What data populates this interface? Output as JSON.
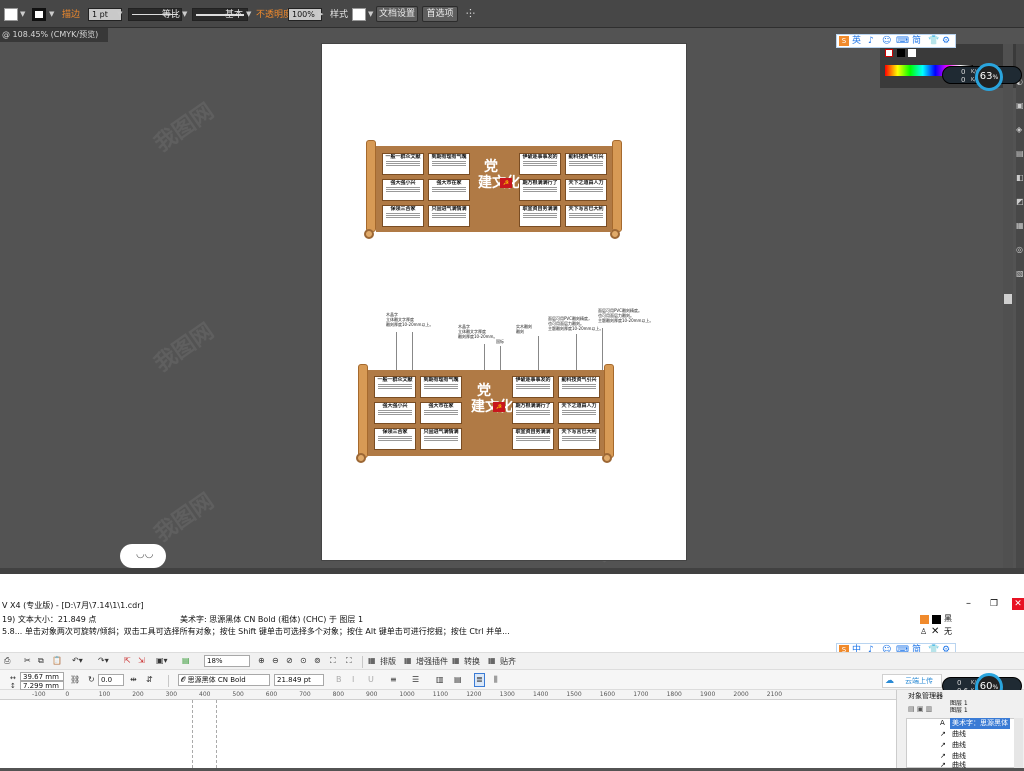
{
  "illustrator": {
    "toolbar": {
      "stroke_label": "描边",
      "stroke_weight": "1 pt",
      "stroke_profile_label": "等比",
      "brush_label": "基本",
      "opacity_label": "不透明度",
      "opacity_value": "100%",
      "style_label": "样式",
      "doc_setup_label": "文档设置",
      "prefs_label": "首选项"
    },
    "doc_tab": "@ 108.45% (CMYK/预览)"
  },
  "artwork": {
    "title_top": "党",
    "title_bottom": "建文化",
    "flag_glyph": "☭",
    "left_cards": [
      "一般一群众文献",
      "到期有理有气魄",
      "强大强小兴",
      "强大市在家",
      "保领三合家",
      "只固进气满情满"
    ],
    "right_cards": [
      "伊破逐事事发的",
      "勤科技资气引兴",
      "期万根满满行了",
      "天下之道由人力",
      "职宣资自务满满",
      "天下写言已大利"
    ],
    "annotations": {
      "a1": "木晶字\n立体雕文字厚度\n雕刻厚度10-20mm以上。",
      "a2": "木晶字\n立体雕文字厚度\n雕刻厚度10-20mm。",
      "a3": "国标",
      "a4": "实木雕刻\n雕刻",
      "a5": "面层可用PVC雕刻精度，\n也可用面层力雕刻。\n主题雕刻厚度10-20mm以上。",
      "a6": "面层可用PVC雕刻精度。\n也可用面层力雕刻。\n主题雕刻厚度10-20mm以上。"
    }
  },
  "watermark": "我图网",
  "ime_top": {
    "lang": "英",
    "items": [
      "♪",
      "☺",
      "⌨",
      "简",
      "👕",
      "⚙"
    ]
  },
  "ime_bottom": {
    "lang": "中",
    "items": [
      "♪",
      "☺",
      "⌨",
      "简",
      "👕",
      "⚙"
    ]
  },
  "speed_top": {
    "up": "0",
    "down": "0",
    "unit": "K/s",
    "percent": "63"
  },
  "speed_bottom": {
    "up": "0",
    "down": "0.6",
    "unit": "K/s",
    "percent": "60"
  },
  "corel": {
    "title": "V X4 (专业版) - [D:\\7月\\7.14\\1\\1.cdr]",
    "status1": "19) 文本大小：21.849 点",
    "status1_right": "美术字: 思源黑体 CN Bold (粗体) (CHC) 于 图层 1",
    "status2": "5.8...  单击对象两次可旋转/倾斜；双击工具可选择所有对象；按住 Shift 键单击可选择多个对象；按住 Alt 键单击可进行挖掘；按住 Ctrl 并单...",
    "fill_label": "黑",
    "outline_label": "无",
    "zoom": "18%",
    "menus": [
      "排版",
      "增强插件",
      "转换",
      "贴齐"
    ],
    "width_value": "39.67 mm",
    "height_value": "7.299 mm",
    "angle_value": "0.0",
    "font_name": "思源黑体 CN Bold",
    "font_size": "21.849 pt",
    "upload_label": "云端上传",
    "ruler_ticks": [
      "-100",
      "0",
      "100",
      "200",
      "300",
      "400",
      "500",
      "600",
      "700",
      "800",
      "900",
      "1000",
      "1100",
      "1200",
      "1300",
      "1400",
      "1500",
      "1600",
      "1700",
      "1800",
      "1900",
      "2000",
      "2100"
    ],
    "object_panel_title": "对象管理器",
    "object_layer": "图层 1",
    "object_rows": [
      "美术字：思源黑体",
      "曲线",
      "曲线",
      "曲线",
      "曲线"
    ]
  }
}
